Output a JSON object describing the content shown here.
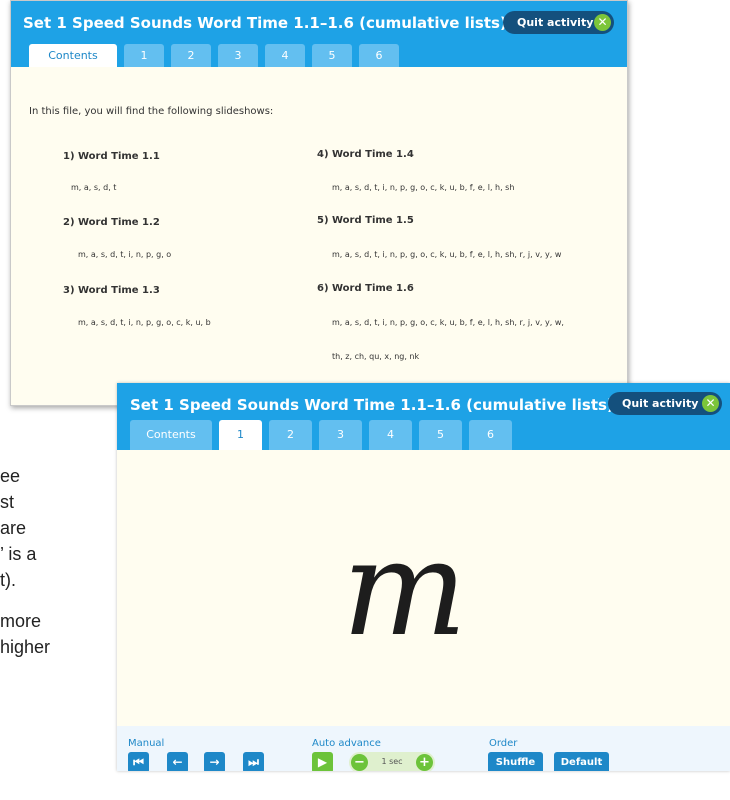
{
  "fragments": [
    "ee",
    "st",
    "are",
    "’ is a",
    "t).",
    "more",
    "higher"
  ],
  "window1": {
    "title": "Set 1 Speed Sounds Word Time 1.1–1.6 (cumulative lists)",
    "quit_label": "Quit activity",
    "tabs": [
      "Contents",
      "1",
      "2",
      "3",
      "4",
      "5",
      "6"
    ],
    "intro": "In this file, you will find the following slideshows:",
    "sections": [
      {
        "heading": "1) Word Time 1.1",
        "letters": "m, a, s, d, t"
      },
      {
        "heading": "2) Word Time 1.2",
        "letters": "m, a, s, d, t, i, n, p, g, o"
      },
      {
        "heading": "3) Word Time 1.3",
        "letters": "m, a, s, d, t, i, n, p, g, o, c, k, u, b"
      },
      {
        "heading": "4) Word Time 1.4",
        "letters": "m, a, s, d, t, i, n, p, g, o, c, k, u, b, f, e, l, h, sh"
      },
      {
        "heading": "5) Word Time 1.5",
        "letters": "m, a, s, d, t, i, n, p, g, o, c, k, u, b, f, e, l, h, sh, r, j, v, y, w"
      },
      {
        "heading": "6) Word Time 1.6",
        "letters": "m, a, s, d, t, i, n, p, g, o, c, k, u, b, f, e, l, h, sh, r, j, v, y, w,",
        "letters2": "th, z, ch, qu, x, ng, nk"
      }
    ]
  },
  "window2": {
    "title": "Set 1 Speed Sounds Word Time 1.1–1.6 (cumulative lists)",
    "quit_label": "Quit activity",
    "tabs": [
      "Contents",
      "1",
      "2",
      "3",
      "4",
      "5",
      "6"
    ],
    "letter": "m",
    "controls": {
      "manual_label": "Manual",
      "auto_label": "Auto advance",
      "order_label": "Order",
      "interval": "1 sec",
      "shuffle": "Shuffle",
      "default": "Default"
    }
  },
  "colors": {
    "header": "#1ea2e6",
    "tab": "#63bff0",
    "quit": "#14507d",
    "green": "#6cc33a",
    "slide_bg": "#fffdf0"
  }
}
